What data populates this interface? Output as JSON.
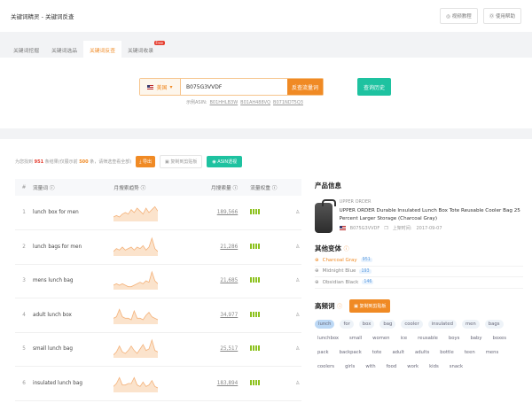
{
  "header": {
    "title": "关键词精灵 - 关键词反查",
    "video_btn": "◎ 视频教程",
    "help_btn": "⓪ 使用帮助"
  },
  "tabs": [
    {
      "label": "关键词挖掘"
    },
    {
      "label": "关键词选品"
    },
    {
      "label": "关键词反查",
      "active": true
    },
    {
      "label": "关键词收录",
      "badge": "Free"
    }
  ],
  "search": {
    "country": "美国",
    "value": "B075G3VVDF",
    "submit": "反查流量词",
    "history": "查询历史",
    "example_label": "示例ASIN:",
    "examples": [
      "B01HHLB3W",
      "B01AH488VQ",
      "B071NDT5Q3"
    ]
  },
  "summary": {
    "prefix": "为您找到",
    "total": "951",
    "mid": "条结果(仅展示前",
    "shown": "500",
    "suffix": "条，请筛选查看全部)",
    "export": "导出",
    "copy": "复制到剪贴板",
    "asin": "ASIN透视"
  },
  "table": {
    "headers": [
      "#",
      "流量词 ⓘ",
      "月搜索趋势 ⓘ",
      "月搜索量 ⓘ",
      "流量权重 ⓘ"
    ],
    "rows": [
      {
        "n": "1",
        "kw": "lunch box for men",
        "vol": "189,566",
        "trend": [
          3,
          4,
          3,
          5,
          6,
          5,
          8,
          6,
          9,
          7,
          5,
          9,
          6,
          8,
          10,
          7
        ]
      },
      {
        "n": "2",
        "kw": "lunch bags for men",
        "vol": "21,286",
        "trend": [
          3,
          5,
          4,
          6,
          4,
          5,
          6,
          4,
          6,
          5,
          7,
          4,
          6,
          12,
          5,
          3
        ]
      },
      {
        "n": "3",
        "kw": "mens lunch bag",
        "vol": "21,685",
        "trend": [
          3,
          4,
          3,
          4,
          3,
          2,
          2,
          3,
          4,
          5,
          4,
          6,
          5,
          12,
          6,
          4
        ]
      },
      {
        "n": "4",
        "kw": "adult lunch box",
        "vol": "34,977",
        "trend": [
          4,
          5,
          10,
          5,
          4,
          4,
          3,
          9,
          4,
          4,
          3,
          6,
          8,
          5,
          4,
          3
        ]
      },
      {
        "n": "5",
        "kw": "small lunch bag",
        "vol": "25,517",
        "trend": [
          2,
          4,
          8,
          4,
          3,
          5,
          8,
          5,
          3,
          6,
          9,
          5,
          6,
          12,
          5,
          4
        ]
      },
      {
        "n": "6",
        "kw": "insulated lunch bag",
        "vol": "183,894",
        "trend": [
          4,
          6,
          10,
          5,
          5,
          6,
          6,
          10,
          5,
          4,
          7,
          4,
          5,
          8,
          4,
          3
        ]
      }
    ]
  },
  "product": {
    "heading": "产品信息",
    "brand": "UPPER ORDER",
    "title": "UPPER ORDER Durable Insulated Lunch Box Tote Reusable Cooler Bag 25 Percent Larger Storage (Charcoal Gray)",
    "asin": "B075G3VVDF",
    "date_label": "上架时间:",
    "date": "2017-09-07"
  },
  "variants": {
    "heading": "其他变体",
    "items": [
      {
        "name": "Charcoal Gray",
        "count": "951"
      },
      {
        "name": "Midnight Blue",
        "count": "193"
      },
      {
        "name": "Obsidian Black",
        "count": "146"
      }
    ]
  },
  "frequent": {
    "heading": "高频词",
    "copy": "复制到剪贴板",
    "words": [
      "lunch",
      "for",
      "box",
      "bag",
      "cooler",
      "insulated",
      "men",
      "bags",
      "lunchbox",
      "small",
      "women",
      "ice",
      "reusable",
      "boys",
      "baby",
      "boxes",
      "pack",
      "backpack",
      "tote",
      "adult",
      "adults",
      "bottle",
      "teen",
      "mens",
      "coolers",
      "girls",
      "with",
      "food",
      "work",
      "kids",
      "snack"
    ]
  }
}
